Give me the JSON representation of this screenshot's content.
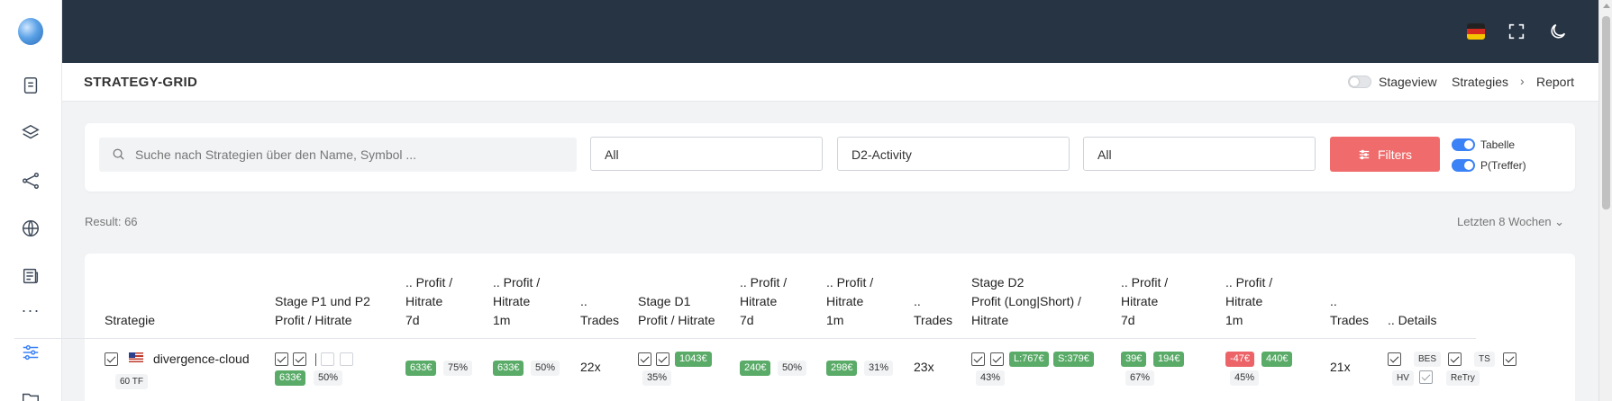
{
  "header": {
    "flag": "de-flag-icon"
  },
  "page": {
    "title": "STRATEGY-GRID",
    "stageview_label": "Stageview",
    "stageview_on": false
  },
  "breadcrumb": {
    "items": [
      "Strategies",
      "Report"
    ],
    "separator": "›"
  },
  "filters": {
    "search_placeholder": "Suche nach Strategien über den Name, Symbol ...",
    "select1": "All",
    "select2": "D2-Activity",
    "select3": "All",
    "filters_button": "Filters",
    "toggle_table": "Tabelle",
    "toggle_probability": "P(Treffer)"
  },
  "summary": {
    "result": "Result: 66",
    "period": "Letzten 8 Wochen ⌄"
  },
  "table": {
    "columns": [
      [
        "Strategie"
      ],
      [
        "Stage P1 und P2",
        "Profit / Hitrate"
      ],
      [
        ".. Profit /",
        "Hitrate",
        "7d"
      ],
      [
        ".. Profit /",
        "Hitrate",
        "1m"
      ],
      [
        "..",
        "Trades"
      ],
      [
        "Stage D1",
        "Profit / Hitrate"
      ],
      [
        ".. Profit /",
        "Hitrate",
        "7d"
      ],
      [
        ".. Profit /",
        "Hitrate",
        "1m"
      ],
      [
        "..",
        "Trades"
      ],
      [
        "Stage D2",
        "Profit (Long|Short) /",
        "Hitrate"
      ],
      [
        ".. Profit /",
        "Hitrate",
        "7d"
      ],
      [
        ".. Profit /",
        "Hitrate",
        "1m"
      ],
      [
        "..",
        "Trades"
      ],
      [
        ".. Details"
      ]
    ],
    "row": {
      "name": "divergence-cloud",
      "tf": "60 TF",
      "p12_profit": "633€",
      "p12_hitrate": "50%",
      "p12_7d_profit": "633€",
      "p12_7d_hitrate": "75%",
      "p12_1m_profit": "633€",
      "p12_1m_hitrate": "50%",
      "p12_trades": "22x",
      "d1_profit": "1043€",
      "d1_hitrate": "35%",
      "d1_7d_profit": "240€",
      "d1_7d_hitrate": "50%",
      "d1_1m_profit": "298€",
      "d1_1m_hitrate": "31%",
      "d1_trades": "23x",
      "d2_long": "L:767€",
      "d2_short": "S:379€",
      "d2_hitrate": "43%",
      "d2_7d_profit_a": "39€",
      "d2_7d_profit_b": "194€",
      "d2_7d_hitrate": "67%",
      "d2_1m_profit_a": "-47€",
      "d2_1m_profit_b": "440€",
      "d2_1m_hitrate": "45%",
      "d2_trades": "21x",
      "detail_bes": "BES",
      "detail_ts": "TS",
      "detail_hv": "HV",
      "detail_retry": "ReTry"
    }
  },
  "colors": {
    "topbar": "#273444",
    "accent": "#3b82f6",
    "filters_button": "#f06b6b",
    "profit_green": "#5aab68",
    "loss_red": "#ec6468"
  }
}
